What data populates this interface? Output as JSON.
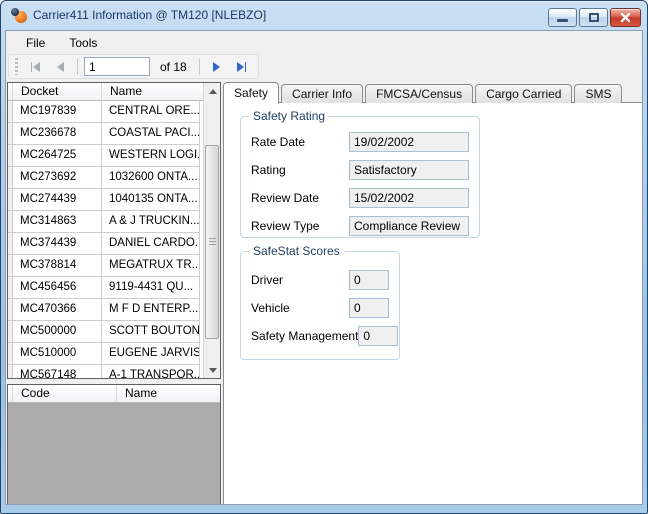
{
  "window": {
    "title": "Carrier411 Information @ TM120 [NLEBZO]"
  },
  "colors": {
    "titlebar_top": "#cadff3",
    "titlebar_bottom": "#9dc0e2",
    "close_button_red": "#c43a28",
    "nav_arrow_active": "#3566c6",
    "nav_arrow_disabled": "#a6aeb8",
    "groupbox_label": "#1e3c5f",
    "empty_grid_body": "#ababab",
    "chrome_gray": "#f0f0f0"
  },
  "icons": {
    "app_icon": "orange-and-navy-spheres-logo",
    "minimize": "dash",
    "maximize": "square",
    "close": "x",
    "nav_first": "bar-left-triangle",
    "nav_prev": "left-triangle",
    "nav_next": "right-triangle",
    "nav_last": "right-triangle-bar",
    "scroll_up": "up-triangle",
    "scroll_down": "down-triangle"
  },
  "menu": {
    "items": [
      {
        "label": "File"
      },
      {
        "label": "Tools"
      }
    ]
  },
  "toolbar": {
    "record_value": "1",
    "record_count_label": "of 18"
  },
  "docket_table": {
    "headers": [
      "Docket",
      "Name"
    ],
    "rows": [
      {
        "docket": "MC197839",
        "name": "CENTRAL ORE..."
      },
      {
        "docket": "MC236678",
        "name": "COASTAL PACI..."
      },
      {
        "docket": "MC264725",
        "name": "WESTERN LOGI..."
      },
      {
        "docket": "MC273692",
        "name": "1032600 ONTA..."
      },
      {
        "docket": "MC274439",
        "name": "1040135 ONTA..."
      },
      {
        "docket": "MC314863",
        "name": "A & J TRUCKIN..."
      },
      {
        "docket": "MC374439",
        "name": "DANIEL CARDO..."
      },
      {
        "docket": "MC378814",
        "name": "MEGATRUX TR..."
      },
      {
        "docket": "MC456456",
        "name": "9119-4431 QU..."
      },
      {
        "docket": "MC470366",
        "name": "M F D  ENTERP..."
      },
      {
        "docket": "MC500000",
        "name": "SCOTT BOUTON"
      },
      {
        "docket": "MC510000",
        "name": "EUGENE JARVIS"
      },
      {
        "docket": "MC567148",
        "name": "A-1 TRANSPOR..."
      }
    ]
  },
  "code_table": {
    "headers": [
      "Code",
      "Name"
    ],
    "rows": []
  },
  "tabs": {
    "active": "Safety",
    "items": [
      "Safety",
      "Carrier Info",
      "FMCSA/Census",
      "Cargo Carried",
      "SMS"
    ]
  },
  "safety_tab": {
    "safety_rating": {
      "title": "Safety Rating",
      "fields": [
        {
          "label": "Rate Date",
          "value": "19/02/2002"
        },
        {
          "label": "Rating",
          "value": "Satisfactory"
        },
        {
          "label": "Review Date",
          "value": "15/02/2002"
        },
        {
          "label": "Review Type",
          "value": "Compliance Review"
        }
      ]
    },
    "safestat_scores": {
      "title": "SafeStat Scores",
      "fields": [
        {
          "label": "Driver",
          "value": "0"
        },
        {
          "label": "Vehicle",
          "value": "0"
        },
        {
          "label": "Safety Management",
          "value": "0"
        }
      ]
    }
  }
}
